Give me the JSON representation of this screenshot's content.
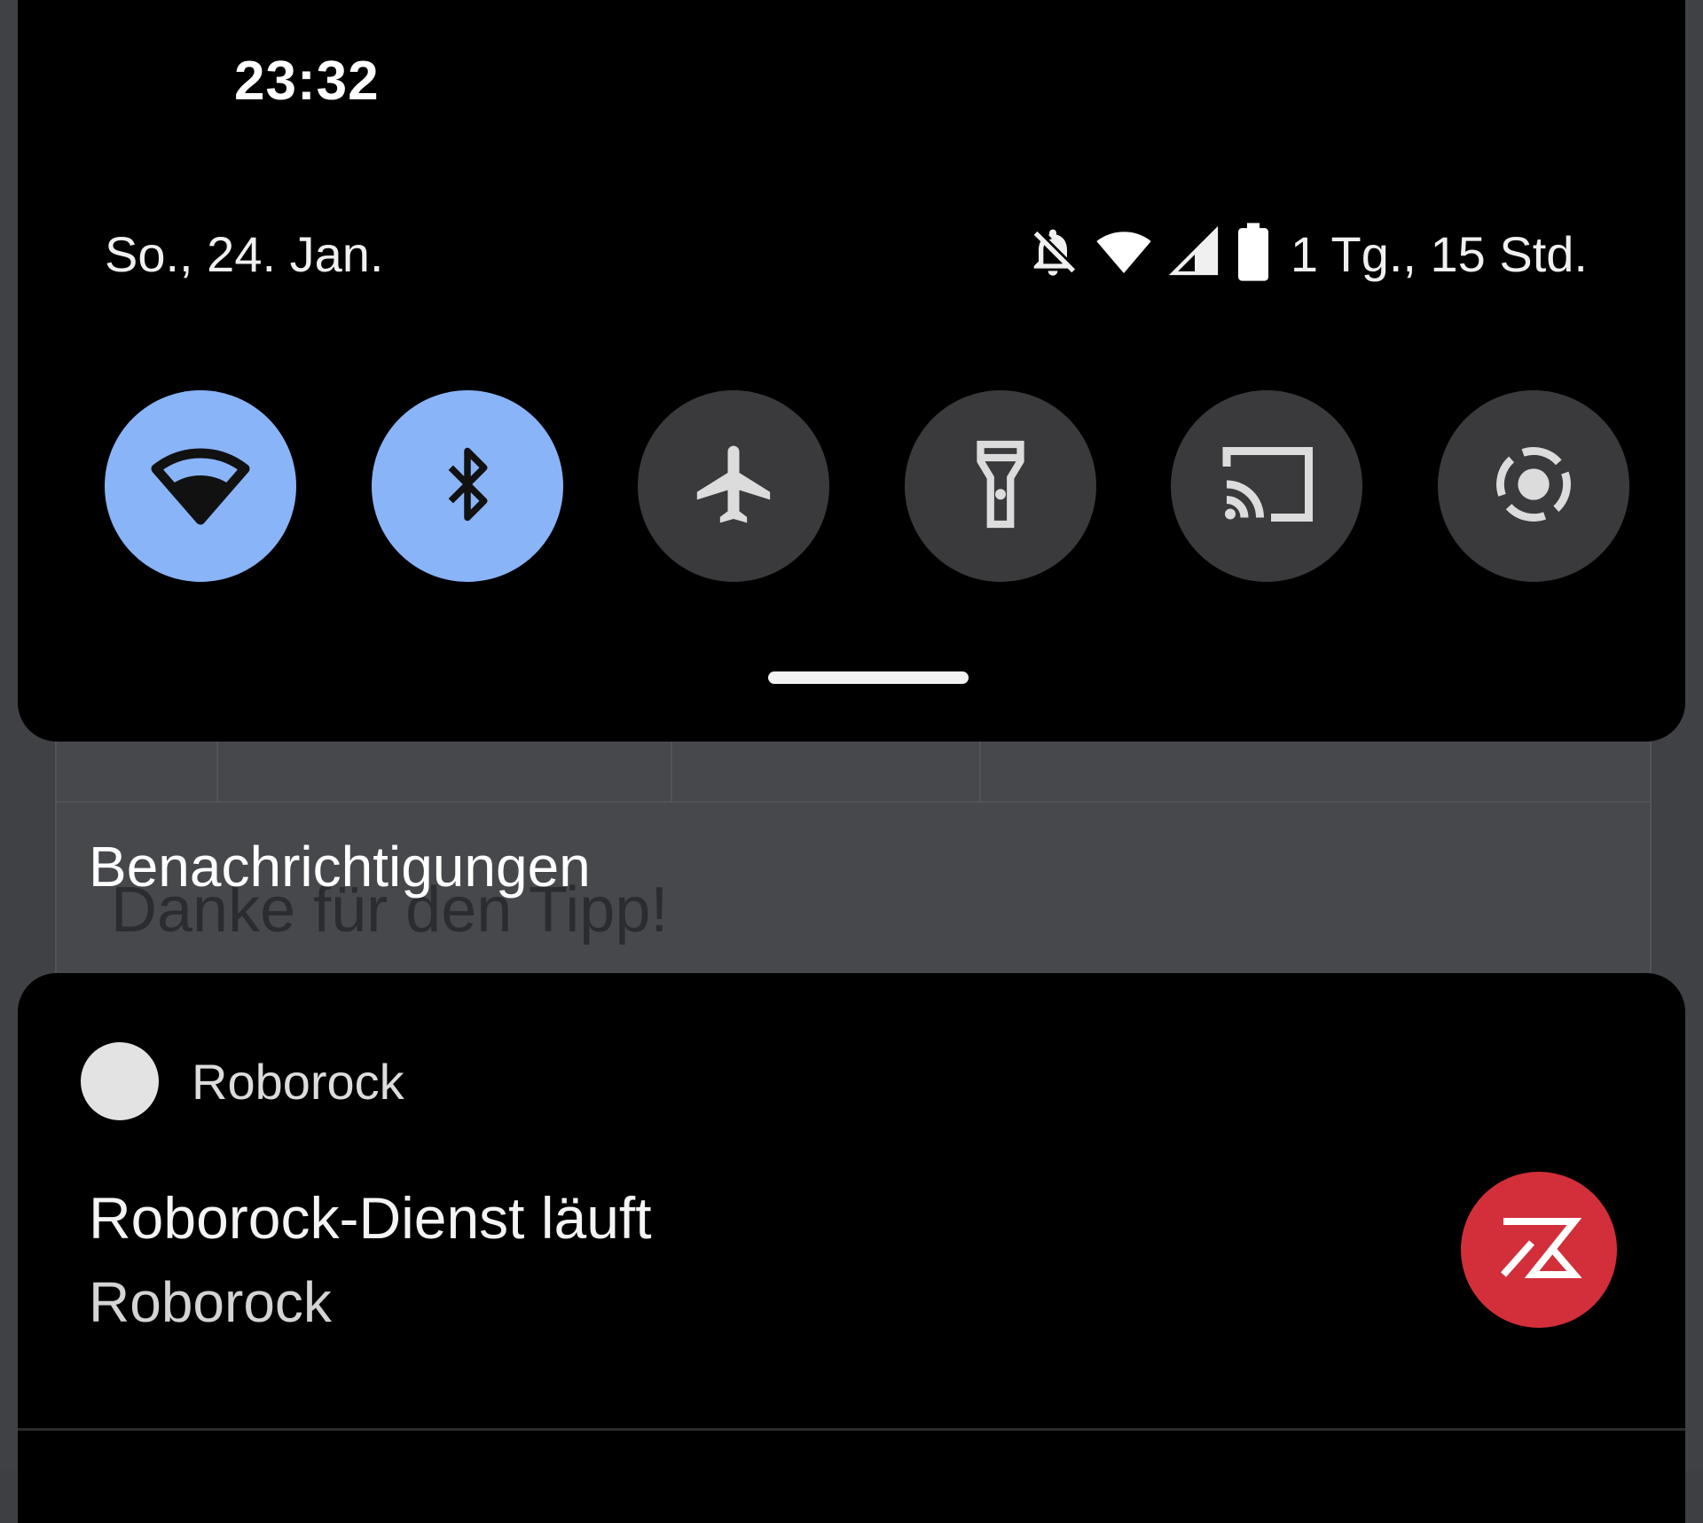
{
  "status_bar": {
    "time": "23:32",
    "date": "So., 24. Jan.",
    "battery_text": "1 Tg., 15 Std.",
    "icons": [
      "notifications-off-icon",
      "wifi-icon",
      "cellular-signal-icon",
      "battery-icon"
    ]
  },
  "quick_settings": {
    "tiles": [
      {
        "icon": "wifi-icon",
        "active": true
      },
      {
        "icon": "bluetooth-icon",
        "active": true
      },
      {
        "icon": "airplane-mode-icon",
        "active": false
      },
      {
        "icon": "flashlight-icon",
        "active": false
      },
      {
        "icon": "cast-icon",
        "active": false
      },
      {
        "icon": "screen-record-icon",
        "active": false
      }
    ],
    "active_color": "#8ab4f8",
    "inactive_color": "#3a3a3c"
  },
  "background_app": {
    "text": "Danke für den Tipp!"
  },
  "notifications": {
    "header": "Benachrichtigungen",
    "items": [
      {
        "app_name": "Roborock",
        "title": "Roborock-Dienst läuft",
        "text": "Roborock",
        "icon": "roborock-logo-icon",
        "icon_color": "#d22f3a"
      }
    ]
  }
}
